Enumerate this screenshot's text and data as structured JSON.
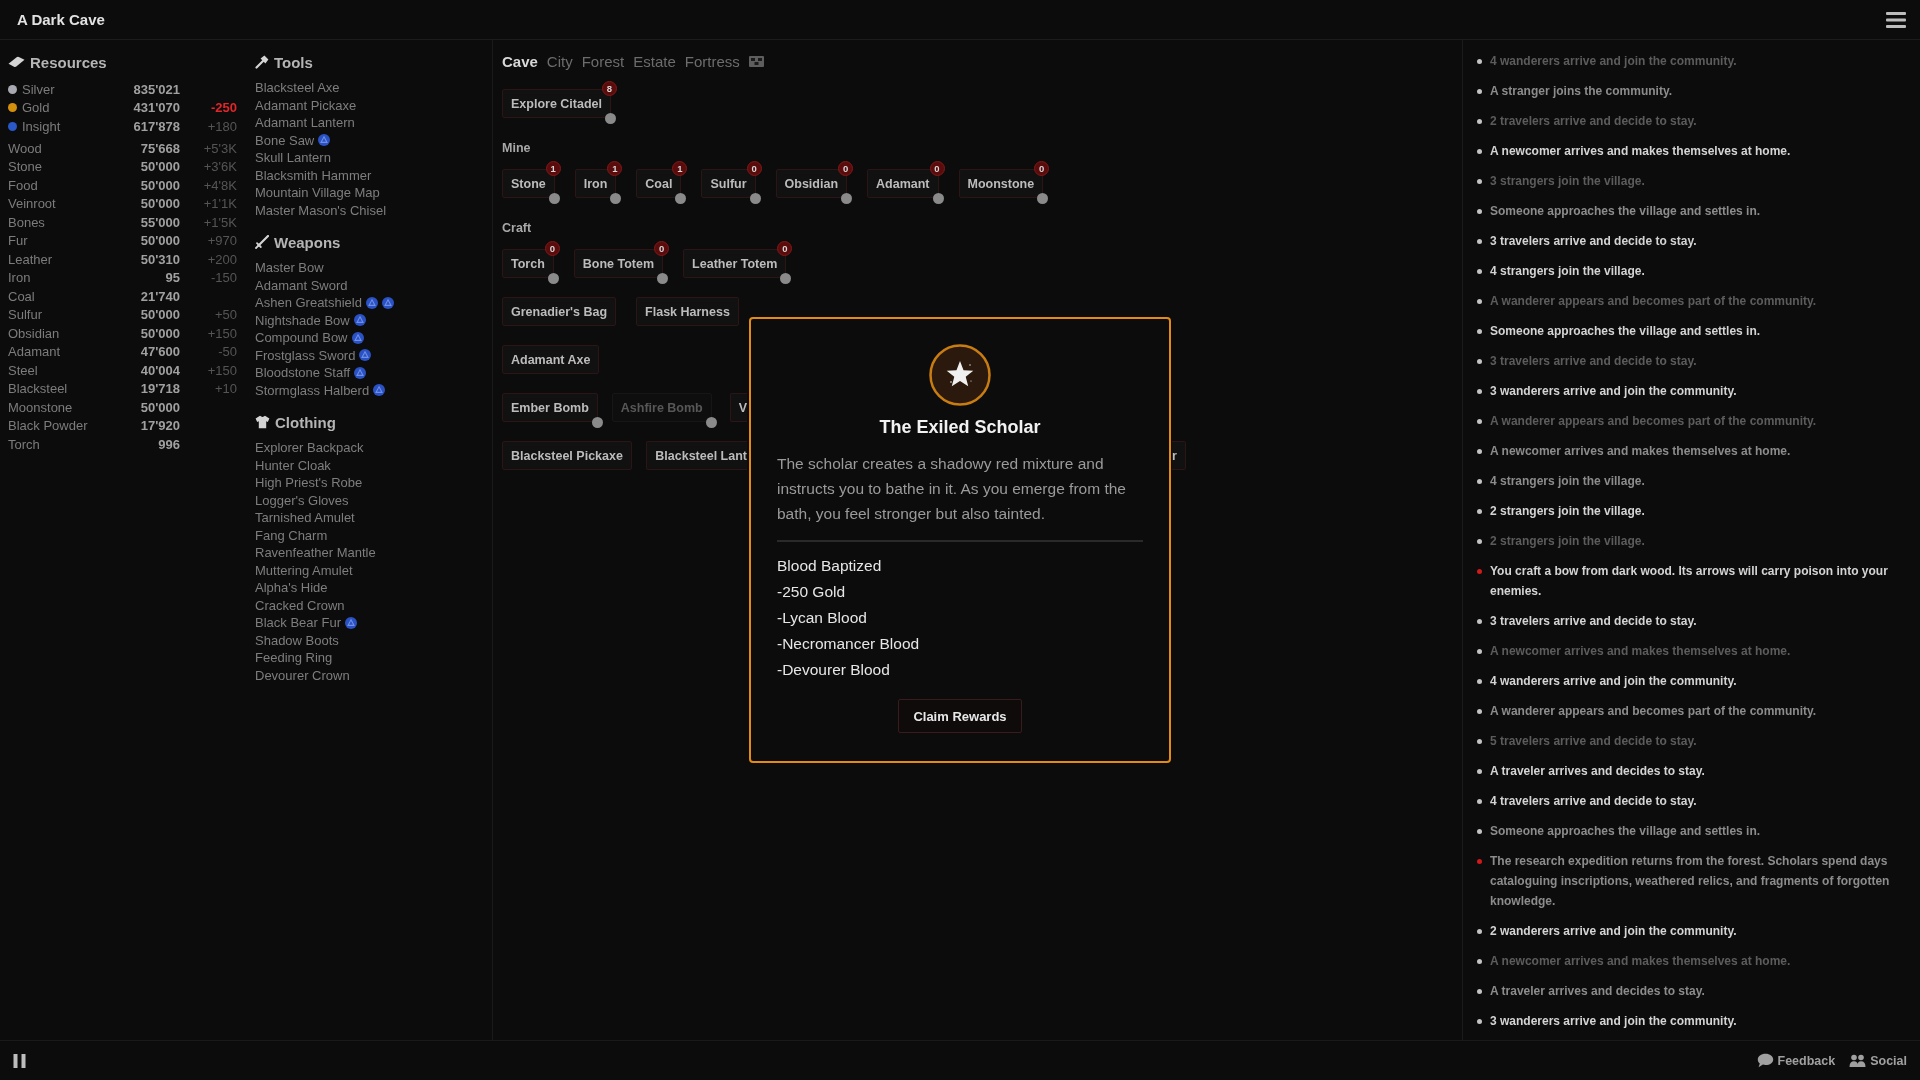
{
  "app": {
    "title": "A Dark Cave"
  },
  "resources": {
    "title": "Resources",
    "currencies": [
      {
        "name": "Silver",
        "value": "835'021",
        "color": "#a9a9b2"
      },
      {
        "name": "Gold",
        "value": "431'070",
        "delta": "-250",
        "delta_alert": true,
        "color": "#d4900c"
      },
      {
        "name": "Insight",
        "value": "617'878",
        "delta": "+180",
        "delta_alert": false,
        "color": "#2a58c8"
      }
    ],
    "materials": [
      {
        "name": "Wood",
        "value": "75'668",
        "delta": "+5'3K",
        "delta_alert": false
      },
      {
        "name": "Stone",
        "value": "50'000",
        "delta": "+3'6K",
        "delta_alert": false
      },
      {
        "name": "Food",
        "value": "50'000",
        "delta": "+4'8K",
        "delta_alert": false
      },
      {
        "name": "Veinroot",
        "value": "50'000",
        "delta": "+1'1K",
        "delta_alert": false
      },
      {
        "name": "Bones",
        "value": "55'000",
        "delta": "+1'5K",
        "delta_alert": false
      },
      {
        "name": "Fur",
        "value": "50'000",
        "delta": "+970",
        "delta_alert": false
      },
      {
        "name": "Leather",
        "value": "50'310",
        "delta": "+200",
        "delta_alert": false
      },
      {
        "name": "Iron",
        "value": "95",
        "delta": "-150",
        "delta_alert": false
      },
      {
        "name": "Coal",
        "value": "21'740"
      },
      {
        "name": "Sulfur",
        "value": "50'000",
        "delta": "+50",
        "delta_alert": false
      },
      {
        "name": "Obsidian",
        "value": "50'000",
        "delta": "+150",
        "delta_alert": false
      },
      {
        "name": "Adamant",
        "value": "47'600",
        "delta": "-50",
        "delta_alert": false
      },
      {
        "name": "Steel",
        "value": "40'004",
        "delta": "+150",
        "delta_alert": false
      },
      {
        "name": "Blacksteel",
        "value": "19'718",
        "delta": "+10",
        "delta_alert": false
      },
      {
        "name": "Moonstone",
        "value": "50'000"
      },
      {
        "name": "Black Powder",
        "value": "17'920"
      },
      {
        "name": "Torch",
        "value": "996"
      }
    ]
  },
  "equipment": {
    "sections": [
      {
        "kind": "tools",
        "title": "Tools",
        "items": [
          {
            "name": "Blacksteel Axe"
          },
          {
            "name": "Adamant Pickaxe"
          },
          {
            "name": "Adamant Lantern"
          },
          {
            "name": "Bone Saw",
            "upgrades": [
              {
                "kind": "rune"
              }
            ]
          },
          {
            "name": "Skull Lantern"
          },
          {
            "name": "Blacksmith Hammer"
          },
          {
            "name": "Mountain Village Map"
          },
          {
            "name": "Master Mason's Chisel"
          }
        ]
      },
      {
        "kind": "weapons",
        "title": "Weapons",
        "items": [
          {
            "name": "Master Bow"
          },
          {
            "name": "Adamant Sword"
          },
          {
            "name": "Ashen Greatshield",
            "upgrades": [
              {
                "kind": "rune"
              },
              {
                "kind": "rune"
              }
            ]
          },
          {
            "name": "Nightshade Bow",
            "upgrades": [
              {
                "kind": "rune"
              }
            ]
          },
          {
            "name": "Compound Bow",
            "upgrades": [
              {
                "kind": "rune"
              }
            ]
          },
          {
            "name": "Frostglass Sword",
            "upgrades": [
              {
                "kind": "rune"
              }
            ]
          },
          {
            "name": "Bloodstone Staff",
            "upgrades": [
              {
                "kind": "rune"
              }
            ]
          },
          {
            "name": "Stormglass Halberd",
            "upgrades": [
              {
                "kind": "rune"
              }
            ]
          }
        ]
      },
      {
        "kind": "clothing",
        "title": "Clothing",
        "items": [
          {
            "name": "Explorer Backpack"
          },
          {
            "name": "Hunter Cloak"
          },
          {
            "name": "High Priest's Robe"
          },
          {
            "name": "Logger's Gloves"
          },
          {
            "name": "Tarnished Amulet"
          },
          {
            "name": "Fang Charm"
          },
          {
            "name": "Ravenfeather Mantle"
          },
          {
            "name": "Muttering Amulet"
          },
          {
            "name": "Alpha's Hide"
          },
          {
            "name": "Cracked Crown"
          },
          {
            "name": "Black Bear Fur",
            "upgrades": [
              {
                "kind": "rune"
              }
            ]
          },
          {
            "name": "Shadow Boots"
          },
          {
            "name": "Feeding Ring"
          },
          {
            "name": "Devourer Crown"
          }
        ]
      }
    ]
  },
  "tabs": [
    {
      "kind": "text",
      "label": "Cave",
      "selected": true
    },
    {
      "kind": "text",
      "label": "City",
      "selected": false
    },
    {
      "kind": "text",
      "label": "Forest",
      "selected": false
    },
    {
      "kind": "text",
      "label": "Estate",
      "selected": false
    },
    {
      "kind": "text",
      "label": "Fortress",
      "selected": false
    },
    {
      "kind": "banner",
      "selected": false
    }
  ],
  "actions": {
    "groups": [
      {
        "rows": [
          {
            "buttons": [
              {
                "kind": "full",
                "label": "Explore Citadel",
                "count": "8",
                "indicator": true,
                "disabled": false
              }
            ]
          }
        ]
      },
      {
        "title": "Mine",
        "rows": [
          {
            "buttons": [
              {
                "kind": "full",
                "label": "Stone",
                "count": "1",
                "indicator": true,
                "disabled": false
              },
              {
                "kind": "full",
                "label": "Iron",
                "count": "1",
                "indicator": true,
                "disabled": false
              },
              {
                "kind": "full",
                "label": "Coal",
                "count": "1",
                "indicator": true,
                "disabled": false
              },
              {
                "kind": "full",
                "label": "Sulfur",
                "count": "0",
                "indicator": true,
                "disabled": false
              },
              {
                "kind": "full",
                "label": "Obsidian",
                "count": "0",
                "indicator": true,
                "disabled": false
              },
              {
                "kind": "full",
                "label": "Adamant",
                "count": "0",
                "indicator": true,
                "disabled": false
              },
              {
                "kind": "full",
                "label": "Moonstone",
                "count": "0",
                "indicator": true,
                "disabled": false
              }
            ]
          }
        ]
      },
      {
        "title": "Craft",
        "rows": [
          {
            "buttons": [
              {
                "kind": "full",
                "label": "Torch",
                "count": "0",
                "indicator": true,
                "disabled": false
              },
              {
                "kind": "full",
                "label": "Bone Totem",
                "count": "0",
                "indicator": true,
                "disabled": false
              },
              {
                "kind": "full",
                "label": "Leather Totem",
                "count": "0",
                "indicator": true,
                "disabled": false
              }
            ]
          },
          {
            "buttons": [
              {
                "kind": "full",
                "label": "Grenadier's Bag",
                "indicator": false,
                "disabled": false
              },
              {
                "kind": "full",
                "label": "Flask Harness",
                "indicator": false,
                "disabled": false
              }
            ]
          },
          {
            "buttons": [
              {
                "kind": "full",
                "label": "Adamant Axe",
                "indicator": false,
                "disabled": false
              }
            ]
          },
          {
            "buttons": [
              {
                "kind": "full",
                "label": "Ember Bomb",
                "indicator": true,
                "disabled": false
              },
              {
                "kind": "full",
                "label": "Ashfire Bomb",
                "indicator": true,
                "disabled": true
              },
              {
                "kind": "head",
                "label": "V",
                "indicator": false,
                "disabled": false
              }
            ]
          },
          {
            "buttons": [
              {
                "kind": "full",
                "label": "Blacksteel Pickaxe",
                "indicator": false,
                "disabled": false
              },
              {
                "kind": "head",
                "label": "Blacksteel Lant",
                "indicator": false,
                "disabled": false
              },
              {
                "kind": "tail",
                "label": "r",
                "indicator": false,
                "disabled": false
              }
            ]
          }
        ]
      }
    ]
  },
  "dialog": {
    "title": "The Exiled Scholar",
    "text": "The scholar creates a shadowy red mixture and instructs you to bathe in it. As you emerge from the bath, you feel stronger but also tainted.",
    "rewards": [
      "Blood Baptized",
      "-250 Gold",
      "-Lycan Blood",
      "-Necromancer Blood",
      "-Devourer Blood"
    ],
    "button": "Claim Rewards"
  },
  "log": [
    {
      "text": "4 wanderers arrive and join the community.",
      "kind": "faint",
      "color": "#c4c4c4"
    },
    {
      "text": "A stranger joins the community.",
      "kind": "muted",
      "color": "#c4c4c4"
    },
    {
      "text": "2 travelers arrive and decide to stay.",
      "kind": "faint",
      "color": "#c4c4c4"
    },
    {
      "text": "A newcomer arrives and makes themselves at home.",
      "kind": "bright",
      "color": "#c4c4c4"
    },
    {
      "text": "3 strangers join the village.",
      "kind": "faint",
      "color": "#c4c4c4"
    },
    {
      "text": "Someone approaches the village and settles in.",
      "kind": "muted",
      "color": "#c4c4c4"
    },
    {
      "text": "3 travelers arrive and decide to stay.",
      "kind": "bright",
      "color": "#c4c4c4"
    },
    {
      "text": "4 strangers join the village.",
      "kind": "bright",
      "color": "#c4c4c4"
    },
    {
      "text": "A wanderer appears and becomes part of the community.",
      "kind": "faint",
      "color": "#c4c4c4"
    },
    {
      "text": "Someone approaches the village and settles in.",
      "kind": "bright",
      "color": "#c4c4c4"
    },
    {
      "text": "3 travelers arrive and decide to stay.",
      "kind": "faint",
      "color": "#c4c4c4"
    },
    {
      "text": "3 wanderers arrive and join the community.",
      "kind": "bright",
      "color": "#c4c4c4"
    },
    {
      "text": "A wanderer appears and becomes part of the community.",
      "kind": "faint",
      "color": "#c4c4c4"
    },
    {
      "text": "A newcomer arrives and makes themselves at home.",
      "kind": "muted",
      "color": "#c4c4c4"
    },
    {
      "text": "4 strangers join the village.",
      "kind": "muted",
      "color": "#c4c4c4"
    },
    {
      "text": "2 strangers join the village.",
      "kind": "bright",
      "color": "#c4c4c4"
    },
    {
      "text": "2 strangers join the village.",
      "kind": "faint",
      "color": "#c4c4c4"
    },
    {
      "text": "You craft a bow from dark wood. Its arrows will carry poison into your enemies.",
      "kind": "bright",
      "color": "#d11a1a"
    },
    {
      "text": "3 travelers arrive and decide to stay.",
      "kind": "bright",
      "color": "#c4c4c4"
    },
    {
      "text": "A newcomer arrives and makes themselves at home.",
      "kind": "faint",
      "color": "#c4c4c4"
    },
    {
      "text": "4 wanderers arrive and join the community.",
      "kind": "bright",
      "color": "#c4c4c4"
    },
    {
      "text": "A wanderer appears and becomes part of the community.",
      "kind": "muted",
      "color": "#c4c4c4"
    },
    {
      "text": "5 travelers arrive and decide to stay.",
      "kind": "faint",
      "color": "#c4c4c4"
    },
    {
      "text": "A traveler arrives and decides to stay.",
      "kind": "bright",
      "color": "#c4c4c4"
    },
    {
      "text": "4 travelers arrive and decide to stay.",
      "kind": "bright",
      "color": "#c4c4c4"
    },
    {
      "text": "Someone approaches the village and settles in.",
      "kind": "muted",
      "color": "#c4c4c4"
    },
    {
      "text": "The research expedition returns from the forest. Scholars spend days cataloguing inscriptions, weathered relics, and fragments of forgotten knowledge.",
      "kind": "muted",
      "color": "#d11a1a"
    },
    {
      "text": "2 wanderers arrive and join the community.",
      "kind": "bright",
      "color": "#c4c4c4"
    },
    {
      "text": "A newcomer arrives and makes themselves at home.",
      "kind": "faint",
      "color": "#c4c4c4"
    },
    {
      "text": "A traveler arrives and decides to stay.",
      "kind": "muted",
      "color": "#c4c4c4"
    },
    {
      "text": "3 wanderers arrive and join the community.",
      "kind": "bright",
      "color": "#c4c4c4"
    }
  ],
  "footer": {
    "links": [
      {
        "kind": "feedback",
        "label": "Feedback"
      },
      {
        "kind": "social",
        "label": "Social"
      }
    ]
  }
}
